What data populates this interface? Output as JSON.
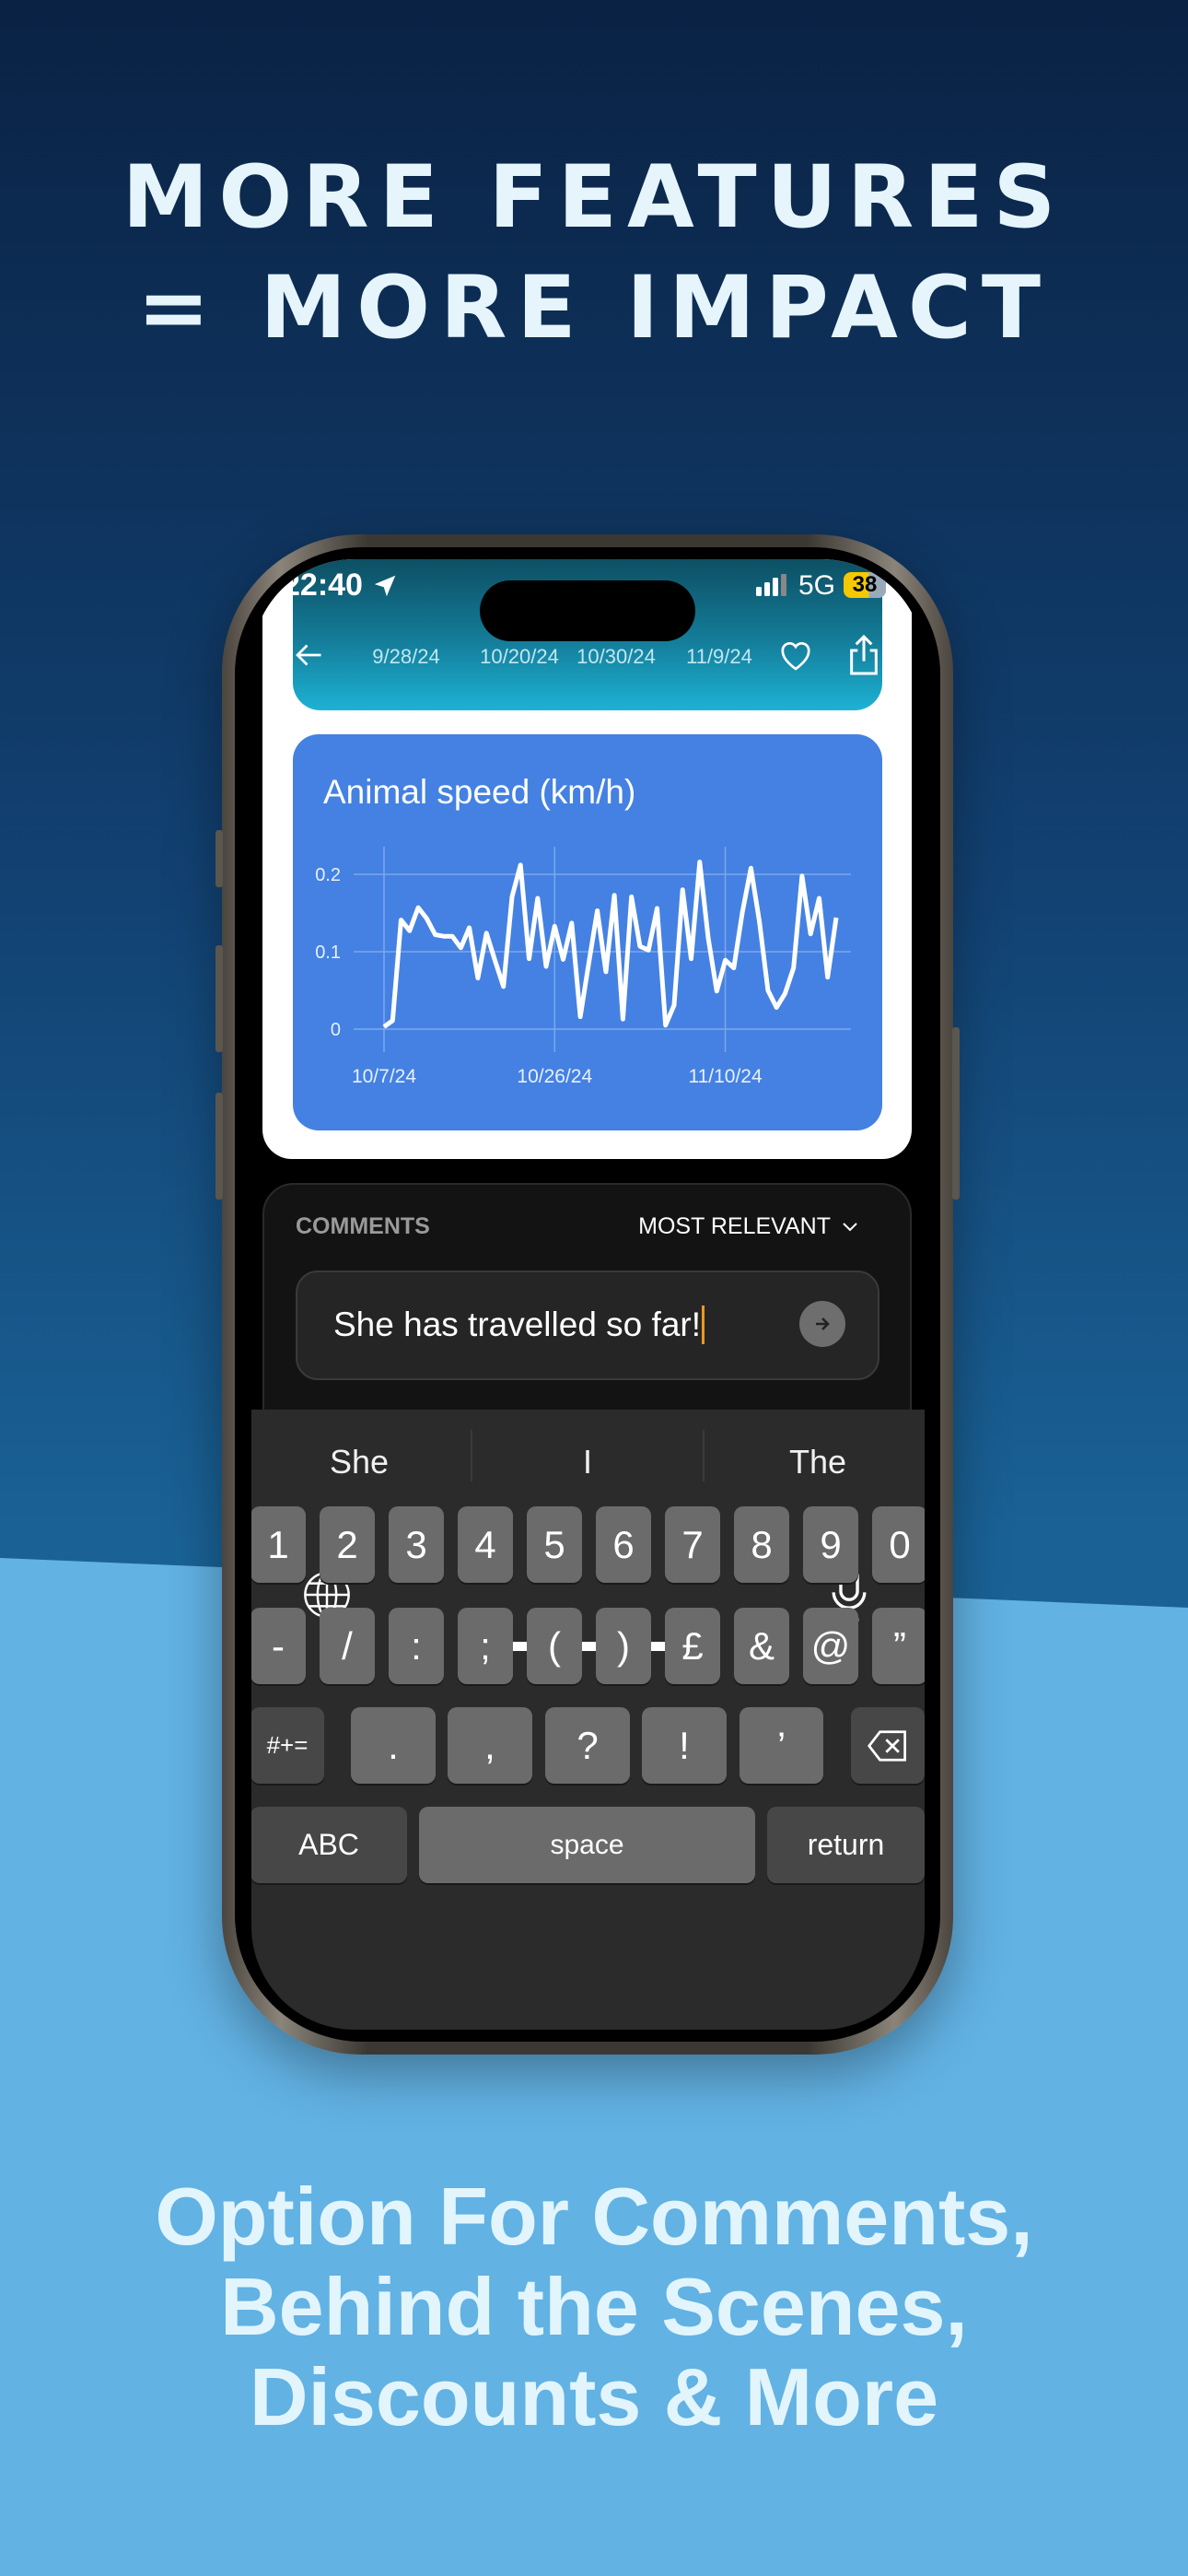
{
  "marketing": {
    "headline": [
      "MORE FEATURES",
      "= MORE IMPACT"
    ],
    "subline": [
      "Option For Comments,",
      "Behind the Scenes,",
      "Discounts & More"
    ],
    "colors": {
      "top_bg": "#0a2244",
      "bottom_bg": "#62b2e4",
      "chart_card": "#4481e2"
    }
  },
  "status_bar": {
    "time": "22:40",
    "network": "5G",
    "battery": "38",
    "icons": [
      "location-arrow-icon",
      "signal-icon",
      "battery-icon"
    ]
  },
  "header": {
    "dates": [
      "9/28/24",
      "10/20/24",
      "10/30/24",
      "11/9/24"
    ],
    "icons": [
      "back-arrow-icon",
      "heart-icon",
      "share-icon"
    ]
  },
  "chart_data": {
    "type": "line",
    "title": "Animal speed (km/h)",
    "x_ticks": [
      "10/7/24",
      "10/26/24",
      "11/10/24"
    ],
    "y_ticks": [
      "0",
      "0.1",
      "0.2"
    ],
    "ylim": [
      0,
      0.23
    ],
    "grid": true,
    "line_color": "#ffffff",
    "values": [
      0.003,
      0.011,
      0.141,
      0.127,
      0.157,
      0.143,
      0.122,
      0.12,
      0.12,
      0.105,
      0.131,
      0.066,
      0.124,
      0.089,
      0.055,
      0.171,
      0.212,
      0.091,
      0.169,
      0.081,
      0.133,
      0.09,
      0.137,
      0.016,
      0.085,
      0.153,
      0.074,
      0.173,
      0.013,
      0.171,
      0.107,
      0.102,
      0.156,
      0.005,
      0.031,
      0.18,
      0.091,
      0.216,
      0.118,
      0.049,
      0.089,
      0.079,
      0.151,
      0.208,
      0.139,
      0.05,
      0.028,
      0.046,
      0.079,
      0.198,
      0.123,
      0.169,
      0.067,
      0.144
    ]
  },
  "comments": {
    "title": "COMMENTS",
    "sort_label": "MOST RELEVANT",
    "input_value": "She has travelled so far!",
    "caret_color": "#f0961e"
  },
  "keyboard": {
    "suggestions": [
      "She",
      "I",
      "The"
    ],
    "row1": [
      "1",
      "2",
      "3",
      "4",
      "5",
      "6",
      "7",
      "8",
      "9",
      "0"
    ],
    "row2": [
      "-",
      "/",
      ":",
      ";",
      "(",
      ")",
      "£",
      "&",
      "@",
      "”"
    ],
    "row3": [
      "#+=",
      ".",
      ",",
      "?",
      "!",
      "’"
    ],
    "row4": [
      "ABC",
      "space",
      "return"
    ]
  }
}
